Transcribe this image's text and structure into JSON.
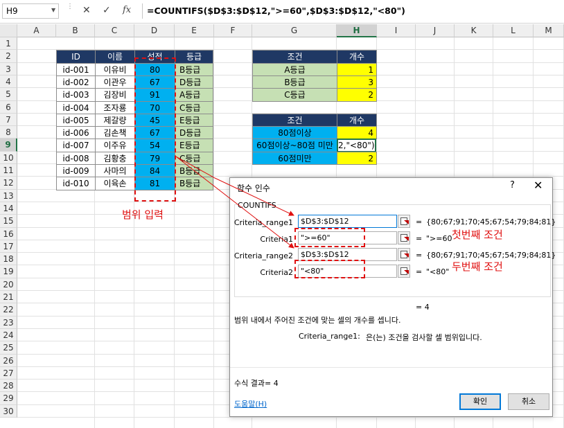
{
  "formula_bar": {
    "name_box": "H9",
    "cancel_icon": "✕",
    "confirm_icon": "✓",
    "fx_icon": "fx",
    "formula": "=COUNTIFS($D$3:$D$12,\">=60\",$D$3:$D$12,\"<80\")"
  },
  "columns": [
    "A",
    "B",
    "C",
    "D",
    "E",
    "F",
    "G",
    "H",
    "I",
    "J",
    "K",
    "L",
    "M"
  ],
  "rows": [
    "1",
    "2",
    "3",
    "4",
    "5",
    "6",
    "7",
    "8",
    "9",
    "10",
    "11",
    "12",
    "13",
    "14",
    "15",
    "16",
    "17",
    "18",
    "19",
    "20",
    "21",
    "22",
    "23",
    "24",
    "25",
    "26",
    "27",
    "28",
    "29",
    "30"
  ],
  "main_table": {
    "headers": [
      "ID",
      "이름",
      "성적",
      "등급"
    ],
    "rows": [
      [
        "id-001",
        "이유비",
        "80",
        "B등급"
      ],
      [
        "id-002",
        "이관우",
        "67",
        "D등급"
      ],
      [
        "id-003",
        "김장비",
        "91",
        "A등급"
      ],
      [
        "id-004",
        "조자룡",
        "70",
        "C등급"
      ],
      [
        "id-005",
        "제갈량",
        "45",
        "E등급"
      ],
      [
        "id-006",
        "김손책",
        "67",
        "D등급"
      ],
      [
        "id-007",
        "이주유",
        "54",
        "E등급"
      ],
      [
        "id-008",
        "김황충",
        "79",
        "C등급"
      ],
      [
        "id-009",
        "사마의",
        "84",
        "B등급"
      ],
      [
        "id-010",
        "이육손",
        "81",
        "B등급"
      ]
    ]
  },
  "grade_table": {
    "headers": [
      "조건",
      "개수"
    ],
    "rows": [
      [
        "A등급",
        "1"
      ],
      [
        "B등급",
        "3"
      ],
      [
        "C등급",
        "2"
      ]
    ]
  },
  "range_table": {
    "headers": [
      "조건",
      "개수"
    ],
    "rows": [
      [
        "80점이상",
        "4"
      ],
      [
        "60점이상~80점 미만",
        "2,\"<80\")"
      ],
      [
        "60점미만",
        "2"
      ]
    ]
  },
  "annotations": {
    "range_input": "범위 입력",
    "first_condition": "첫번째 조건",
    "second_condition": "두번째 조건"
  },
  "dialog": {
    "title": "함수 인수",
    "help_icon": "?",
    "close_icon": "✕",
    "function_name": "COUNTIFS",
    "args": [
      {
        "label": "Criteria_range1",
        "value": "$D$3:$D$12",
        "eq": "=",
        "result": "{80;67;91;70;45;67;54;79;84;81}"
      },
      {
        "label": "Criteria1",
        "value": "\">=60\"",
        "eq": "=",
        "result": "\">=60"
      },
      {
        "label": "Criteria_range2",
        "value": "$D$3:$D$12",
        "eq": "=",
        "result": "{80;67;91;70;45;67;54;79;84;81}"
      },
      {
        "label": "Criteria2",
        "value": "\"<80\"",
        "eq": "=",
        "result": "\"<80\""
      }
    ],
    "overall_result": "=  4",
    "description": "범위 내에서 주어진 조건에 맞는 셀의 개수를 셉니다.",
    "arg_help_name": "Criteria_range1:",
    "arg_help_text": "은(는) 조건을 검사할 셀 범위입니다.",
    "formula_result": "수식 결과=  4",
    "help_link": "도움말(H)",
    "ok_label": "확인",
    "cancel_label": "취소"
  },
  "colors": {
    "header_dark": "#1f3864",
    "score_blue": "#00b0f0",
    "grade_green": "#c6e0b4",
    "count_yellow": "#ffff00",
    "annotation_red": "#e01010",
    "excel_green": "#217346"
  }
}
